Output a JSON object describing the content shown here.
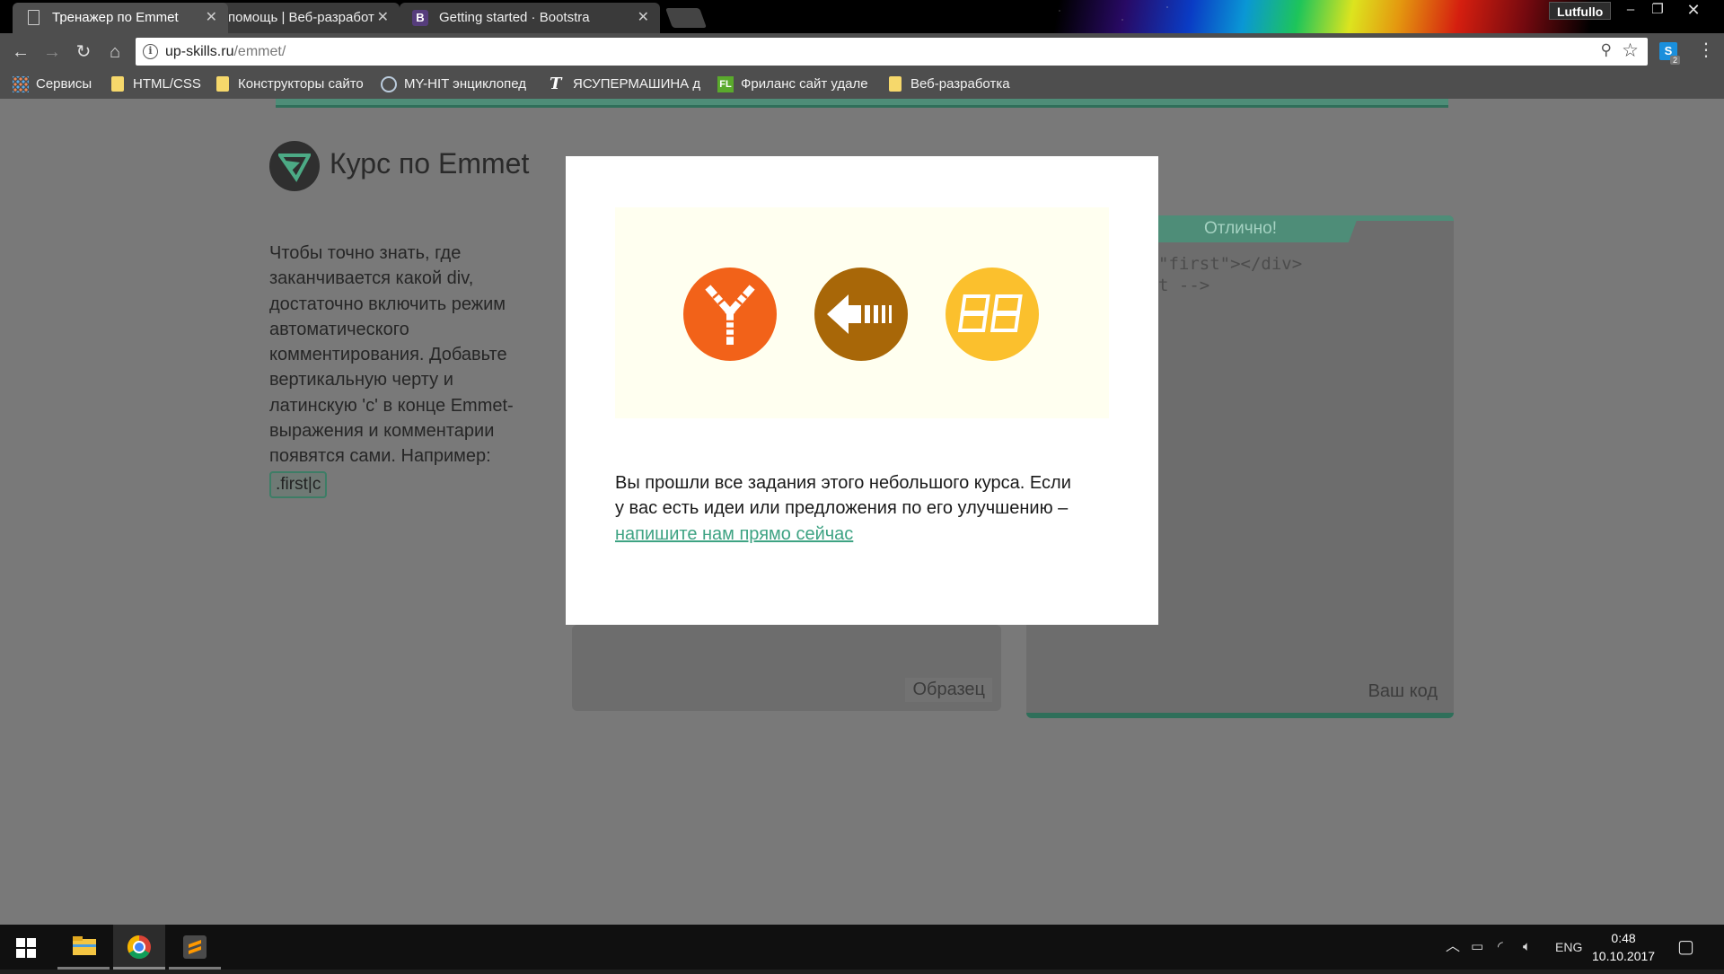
{
  "browser": {
    "tabs": [
      {
        "title": "Тренажер по Emmet",
        "active": true
      },
      {
        "title": "помощь | Веб-разработ",
        "active": false
      },
      {
        "title": "Getting started · Bootstra",
        "active": false
      }
    ],
    "user": "Lutfullo",
    "address": {
      "host": "up-skills.ru",
      "path": "/emmet/"
    },
    "extension_badge": "2",
    "bookmarks": [
      {
        "label": "Сервисы",
        "icon": "apps-icon"
      },
      {
        "label": "HTML/CSS",
        "icon": "folder-icon"
      },
      {
        "label": "Конструкторы сайто",
        "icon": "folder-icon"
      },
      {
        "label": "MY-HIT энциклопед",
        "icon": "globe-icon"
      },
      {
        "label": "ЯСУПЕРМАШИНА д",
        "icon": "t-icon"
      },
      {
        "label": "Фриланс сайт удале",
        "icon": "fl-icon"
      },
      {
        "label": "Веб-разработка",
        "icon": "folder-icon"
      }
    ]
  },
  "page": {
    "course_title": "Курс по Emmet",
    "lesson_text": "Чтобы точно знать, где заканчивается какой div, достаточно включить режим автоматического комментирования. Добавьте вертикальную черту и латинскую 'c' в конце Emmet-выражения и комментарии появятся сами. Например:",
    "example_code": ".first|c",
    "success_label": "Отлично!",
    "code_line_1": "\"first\"></div>",
    "code_line_2": "t -->",
    "sample_label": "Образец",
    "your_code_label": "Ваш код"
  },
  "modal": {
    "message_before_link": "Вы прошли все задания этого небольшого курса. Если у вас есть идеи или предложения по его улучшению – ",
    "link_text": "напишите нам прямо сейчас",
    "badges": [
      {
        "icon": "fork-icon",
        "color": "#f26219"
      },
      {
        "icon": "arrow-left-icon",
        "color": "#a86708"
      },
      {
        "icon": "digits-icon",
        "color": "#fbc02d"
      }
    ]
  },
  "taskbar": {
    "language": "ENG",
    "time": "0:48",
    "date": "10.10.2017"
  },
  "colors": {
    "accent": "#4e8d78",
    "link": "#3ea383",
    "overlay_page": "#797979"
  }
}
